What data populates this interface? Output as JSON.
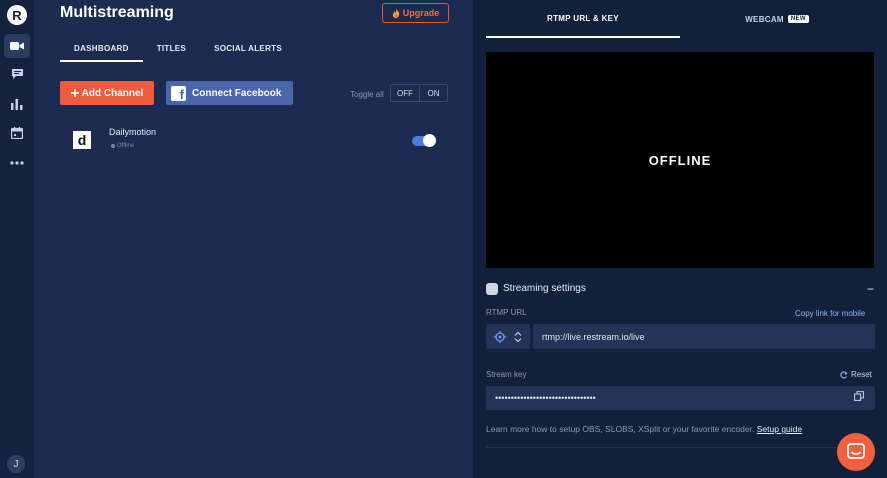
{
  "sidebar": {
    "logo_letter": "R",
    "items": [
      {
        "icon": "video-camera-icon",
        "active": true
      },
      {
        "icon": "chat-bubble-icon",
        "active": false
      },
      {
        "icon": "bar-chart-icon",
        "active": false
      },
      {
        "icon": "calendar-icon",
        "active": false
      },
      {
        "icon": "more-dots-icon",
        "active": false
      }
    ],
    "avatar_letter": "J"
  },
  "main": {
    "title": "Multistreaming",
    "upgrade_label": "Upgrade",
    "tabs": [
      {
        "label": "DASHBOARD",
        "active": true
      },
      {
        "label": "TITLES",
        "active": false
      },
      {
        "label": "SOCIAL ALERTS",
        "active": false
      }
    ],
    "add_channel_label": "Add Channel",
    "connect_facebook_label": "Connect Facebook",
    "toggle_all_label": "Toggle all",
    "toggle_off_label": "OFF",
    "toggle_on_label": "ON",
    "channels": [
      {
        "logo_letter": "d",
        "name": "Dailymotion",
        "status": "Offline",
        "enabled": true
      }
    ]
  },
  "right": {
    "tabs": [
      {
        "label": "RTMP URL & KEY",
        "active": true
      },
      {
        "label": "WEBCAM",
        "badge": "NEW",
        "active": false
      }
    ],
    "preview_status": "OFFLINE",
    "settings_title": "Streaming settings",
    "collapse_symbol": "−",
    "rtmp_url_label": "RTMP URL",
    "copy_link_label": "Copy link for mobile",
    "rtmp_url_value": "rtmp://live.restream.io/live",
    "stream_key_label": "Stream key",
    "reset_label": "Reset",
    "stream_key_value": "••••••••••••••••••••••••••••••••",
    "help_text": "Learn more how to setup OBS, SLOBS, XSplit or your favorite encoder.",
    "setup_guide_label": "Setup guide"
  },
  "colors": {
    "accent_orange": "#f05b3d",
    "facebook_blue": "#4a67ad",
    "toggle_blue": "#4a7ee0",
    "main_bg": "#1c2b4f",
    "panel_bg": "#13203c"
  }
}
